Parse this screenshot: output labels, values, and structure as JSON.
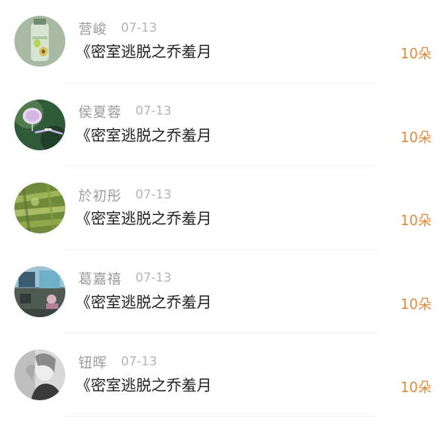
{
  "colors": {
    "name": "#9b9b9b",
    "date": "#b4b4b4",
    "title": "#222222",
    "count": "#e08a3c",
    "divider": "#f0f0f0"
  },
  "items": [
    {
      "name": "营峻",
      "date": "07-13",
      "title": "《密室逃脱之乔羞月",
      "count": "10朵",
      "avatar_icon": "bottle-avatar-icon"
    },
    {
      "name": "侯夏蓉",
      "date": "07-13",
      "title": "《密室逃脱之乔羞月",
      "count": "10朵",
      "avatar_icon": "lantern-avatar-icon"
    },
    {
      "name": "於初彤",
      "date": "07-13",
      "title": "《密室逃脱之乔羞月",
      "count": "10朵",
      "avatar_icon": "grass-avatar-icon"
    },
    {
      "name": "葛嘉禧",
      "date": "07-13",
      "title": "《密室逃脱之乔羞月",
      "count": "10朵",
      "avatar_icon": "street-avatar-icon"
    },
    {
      "name": "钮晖",
      "date": "07-13",
      "title": "《密室逃脱之乔羞月",
      "count": "10朵",
      "avatar_icon": "portrait-avatar-icon"
    }
  ]
}
